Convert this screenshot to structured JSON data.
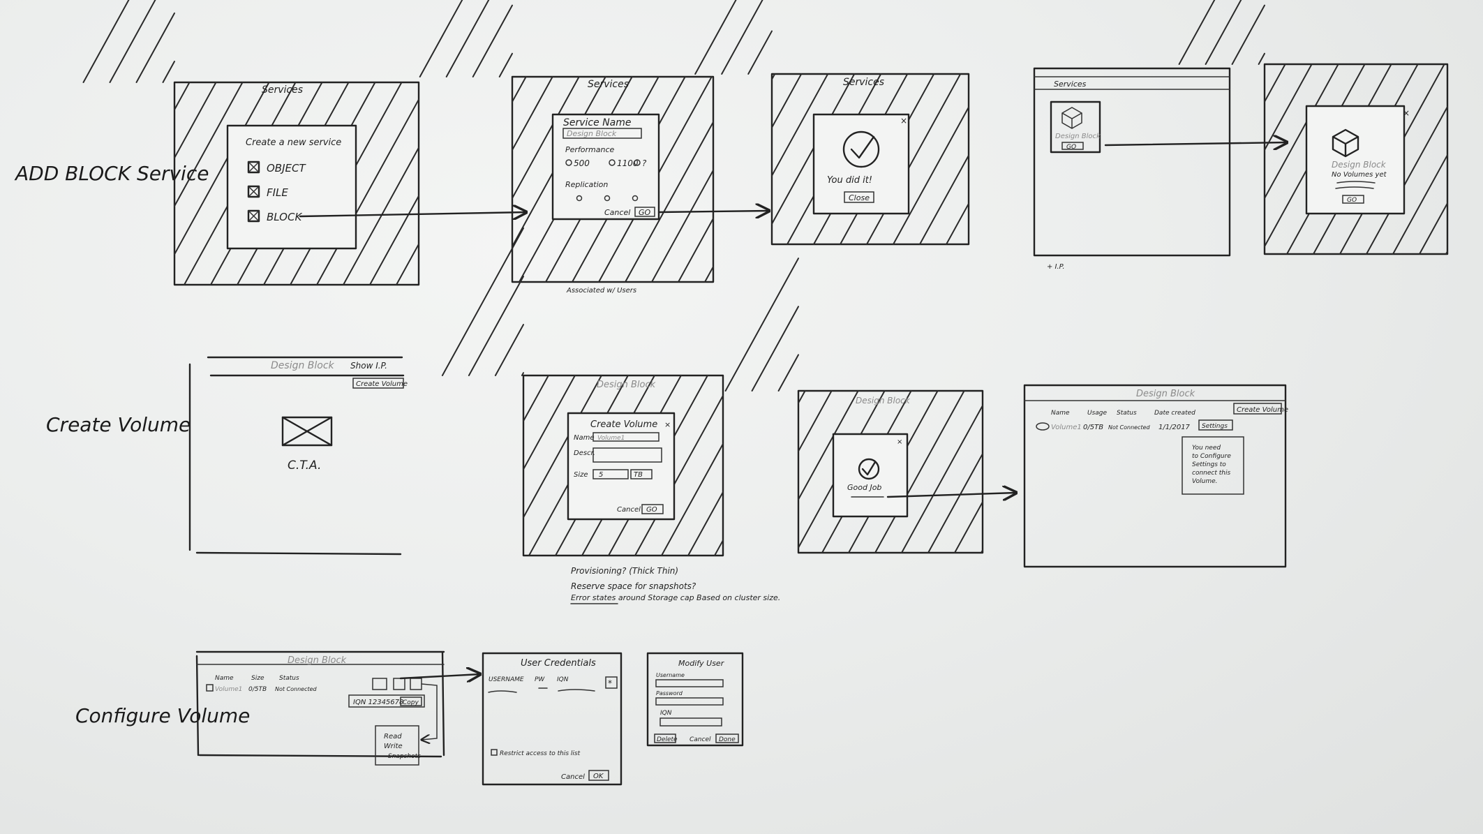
{
  "rows": [
    {
      "label": "ADD BLOCK Service"
    },
    {
      "label": "Create Volume"
    },
    {
      "label": "Configure Volume"
    }
  ],
  "sketch1": {
    "title": "Services",
    "heading": "Create a new service",
    "options": [
      "OBJECT",
      "FILE",
      "BLOCK"
    ]
  },
  "sketch2": {
    "title": "Services",
    "name_label": "Service Name",
    "name_value": "Design Block",
    "perf_label": "Performance",
    "perf_values": [
      "500",
      "1100",
      "?"
    ],
    "rep_label": "Replication",
    "cancel": "Cancel",
    "go": "GO",
    "note": "Associated w/ Users"
  },
  "sketch3": {
    "title": "Services",
    "message": "You did it!",
    "close": "Close"
  },
  "sketch4": {
    "title": "Services",
    "tile": "Design Block",
    "go": "GO",
    "note": "+ I.P."
  },
  "sketch5": {
    "tile": "Design Block",
    "sub": "No Volumes yet",
    "go": "GO"
  },
  "sketch6": {
    "title": "Design Block",
    "show_ip": "Show I.P.",
    "create": "Create Volume",
    "cta": "C.T.A."
  },
  "sketch7": {
    "title": "Design Block",
    "dialog": "Create Volume",
    "name": "Name",
    "name_value": "Volume1",
    "desc": "Descr.",
    "size": "Size",
    "size_value": "5",
    "unit": "TB",
    "cancel": "Cancel",
    "go": "GO",
    "notes": [
      "Provisioning? (Thick Thin)",
      "Reserve space for snapshots?",
      "Error states around Storage cap Based on cluster size."
    ]
  },
  "sketch8": {
    "title": "Design Block",
    "message": "Good Job"
  },
  "sketch9": {
    "title": "Design Block",
    "create": "Create Volume",
    "headers": [
      "Name",
      "Usage",
      "Status",
      "Date created"
    ],
    "row": [
      "Volume1",
      "0/5TB",
      "Not Connected",
      "1/1/2017"
    ],
    "settings": "Settings",
    "tip": [
      "You need",
      "to Configure",
      "Settings to",
      "connect this",
      "Volume."
    ]
  },
  "sketch10": {
    "title": "Design Block",
    "headers": [
      "Name",
      "Size",
      "Status"
    ],
    "row": [
      "Volume1",
      "0/5TB",
      "Not Connected"
    ],
    "iqn": "IQN 12345678",
    "copy": "Copy",
    "perms": [
      "Read",
      "Write",
      "Snapshots"
    ]
  },
  "sketch11": {
    "title": "User Credentials",
    "headers": [
      "USERNAME",
      "PW",
      "IQN"
    ],
    "restrict": "Restrict access to this list",
    "cancel": "Cancel",
    "ok": "OK"
  },
  "sketch12": {
    "title": "Modify User",
    "fields": [
      "Username",
      "Password",
      "IQN"
    ],
    "delete": "Delete",
    "cancel": "Cancel",
    "done": "Done"
  }
}
